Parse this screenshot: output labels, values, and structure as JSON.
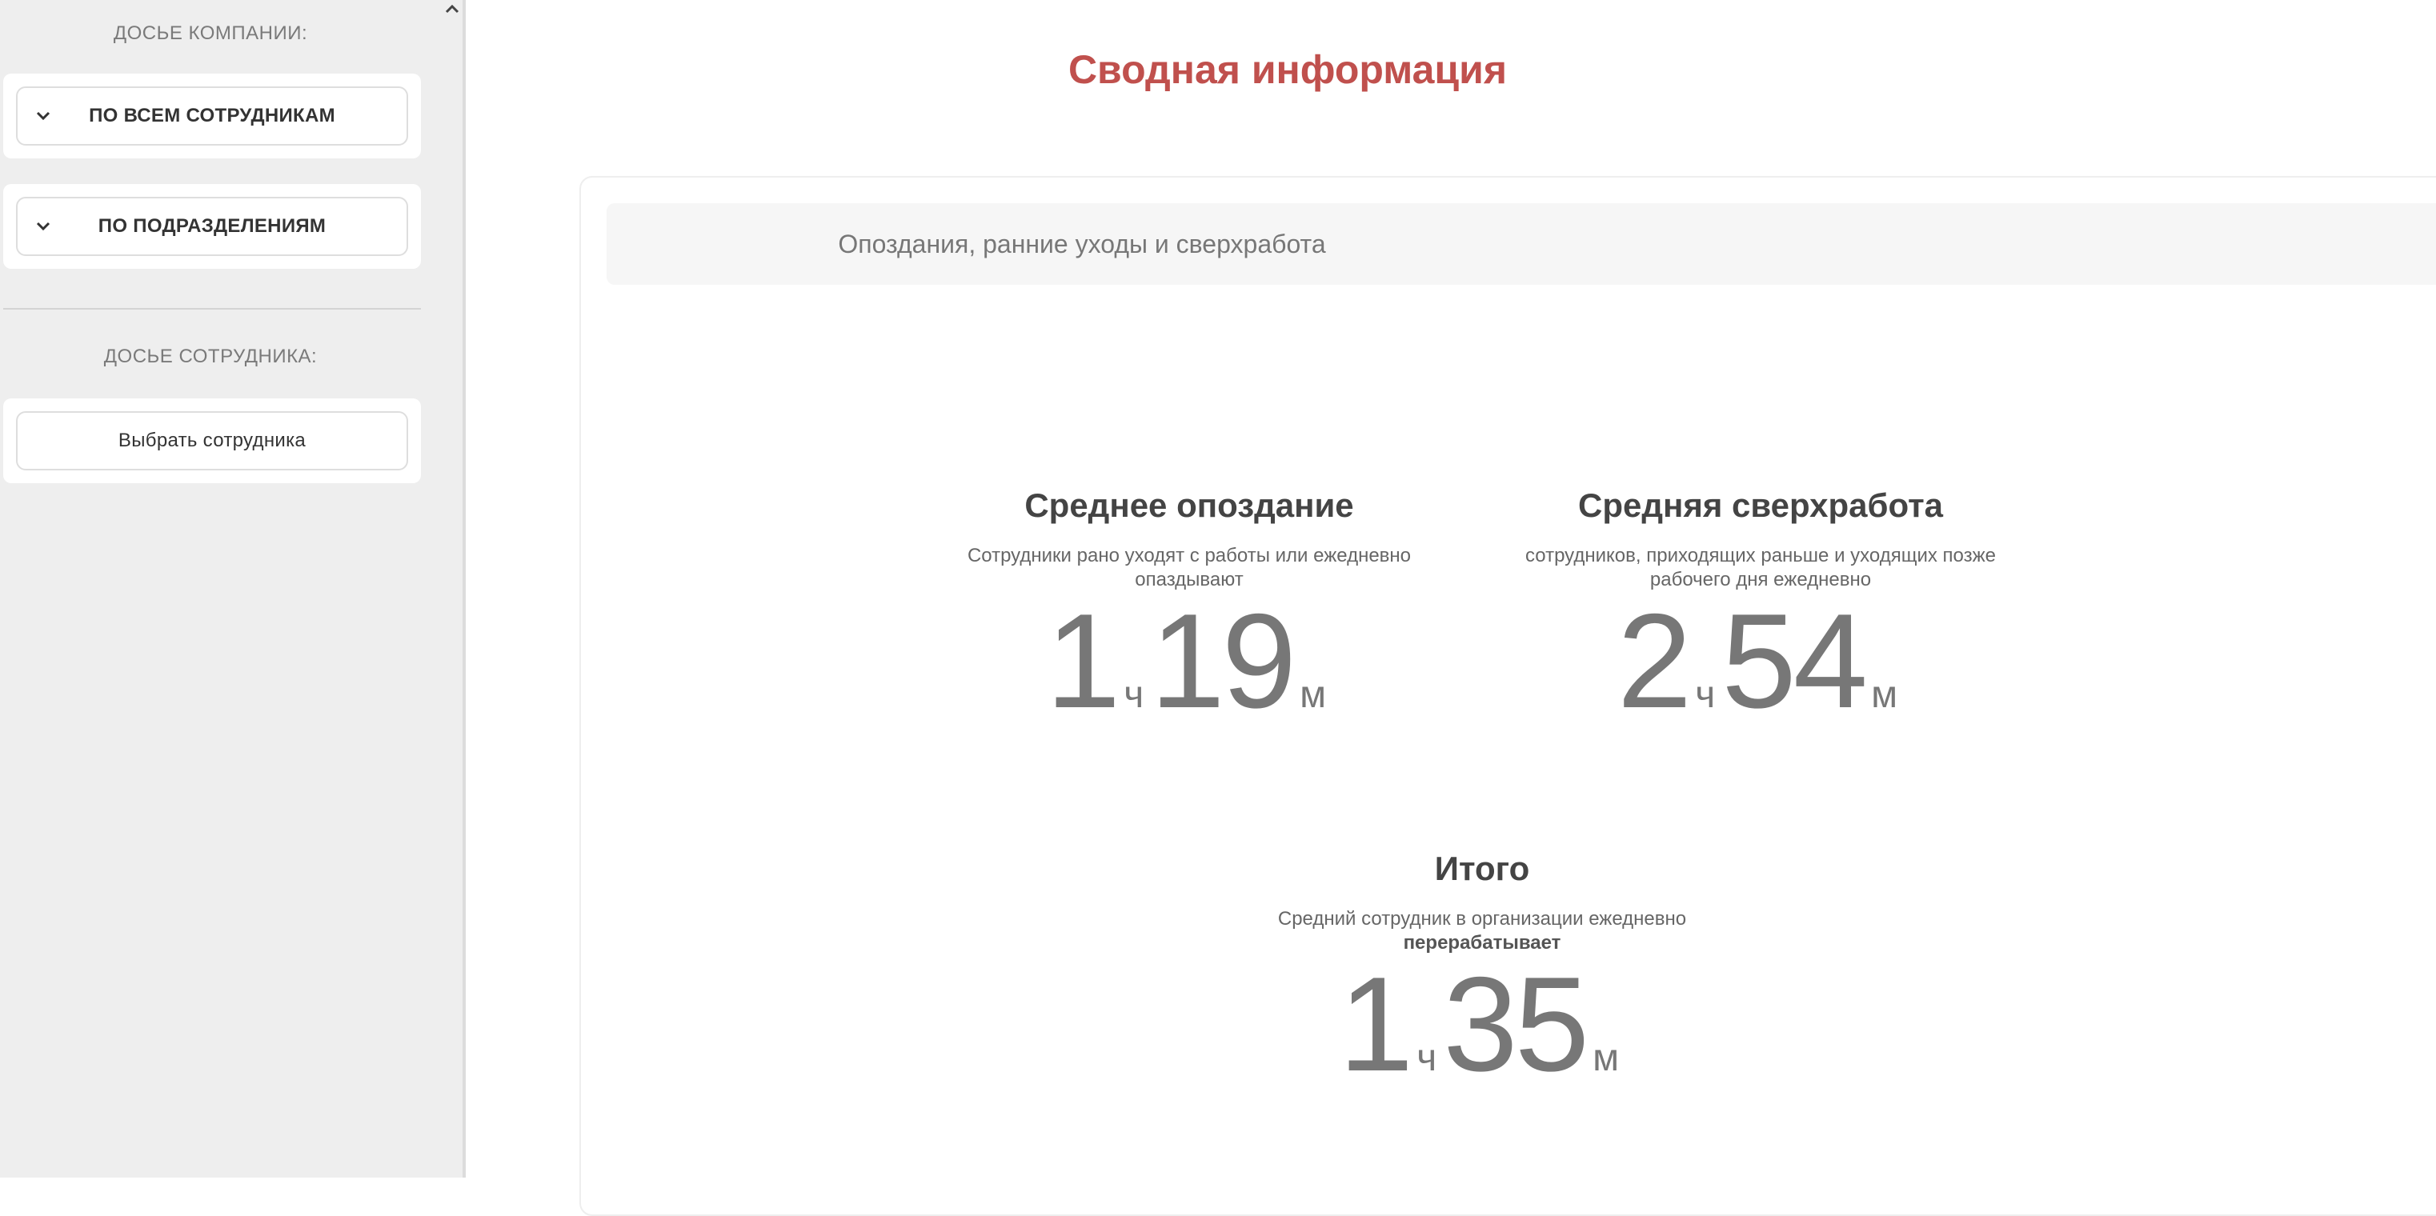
{
  "sidebar": {
    "company_title": "ДОСЬЕ КОМПАНИИ:",
    "all_employees_label": "ПО ВСЕМ СОТРУДНИКАМ",
    "departments_label": "ПО ПОДРАЗДЕЛЕНИЯМ",
    "employee_title": "ДОСЬЕ СОТРУДНИКА:",
    "select_employee_label": "Выбрать сотрудника",
    "icons": {
      "collapse": "chevron-up-icon",
      "dropdown": "chevron-down-icon"
    }
  },
  "main": {
    "title": "Сводная информация",
    "title_color": "#c0504d",
    "panel_header": "Опоздания, ранние уходы и сверхработа",
    "stats": {
      "avg_late": {
        "heading": "Среднее опоздание",
        "desc_line1": "Сотрудники рано уходят с работы или ежедневно",
        "desc_line2": "опаздывают",
        "hours": "1",
        "hours_unit": "ч",
        "minutes": "19",
        "minutes_unit": "м"
      },
      "avg_overtime": {
        "heading": "Средняя сверхработа",
        "desc_line1": "сотрудников, приходящих раньше и уходящих позже",
        "desc_line2": "рабочего дня ежедневно",
        "hours": "2",
        "hours_unit": "ч",
        "minutes": "54",
        "minutes_unit": "м"
      },
      "total": {
        "heading": "Итого",
        "desc_line1": "Средний сотрудник в организации ежедневно",
        "desc_line2": "перерабатывает",
        "hours": "1",
        "hours_unit": "ч",
        "minutes": "35",
        "minutes_unit": "м"
      }
    }
  }
}
